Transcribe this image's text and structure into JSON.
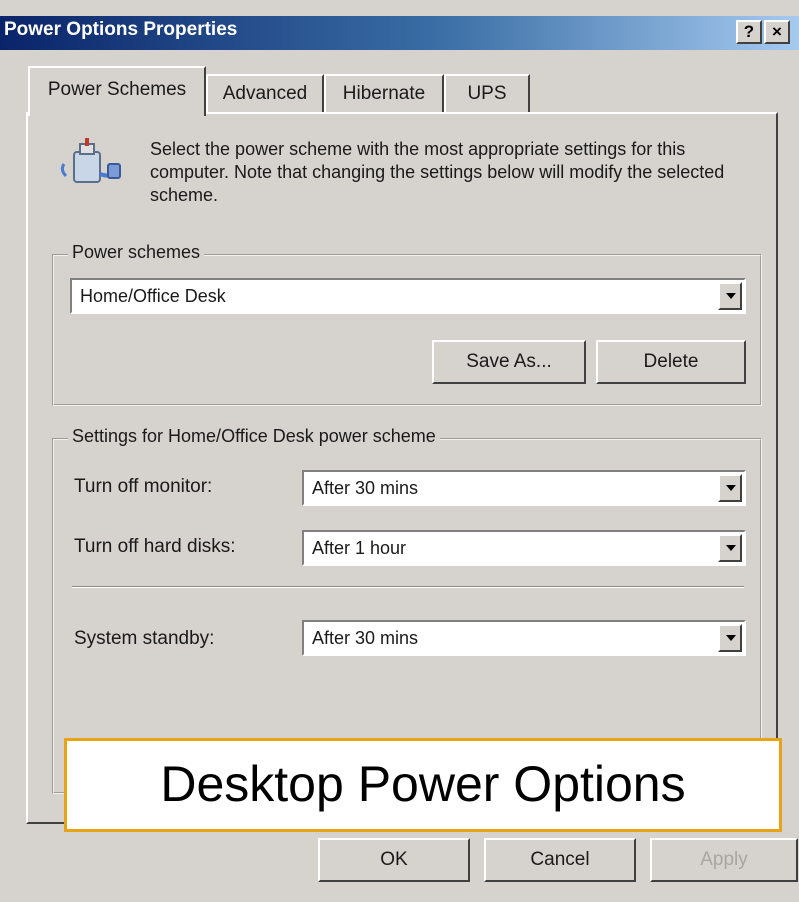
{
  "window": {
    "title": "Power Options Properties",
    "help_glyph": "?",
    "close_glyph": "×"
  },
  "tabs": [
    {
      "label": "Power Schemes",
      "active": true
    },
    {
      "label": "Advanced",
      "active": false
    },
    {
      "label": "Hibernate",
      "active": false
    },
    {
      "label": "UPS",
      "active": false
    }
  ],
  "intro": {
    "icon": "power-scheme-icon",
    "text": "Select the power scheme with the most appropriate settings for this computer. Note that changing the settings below will modify the selected scheme."
  },
  "power_schemes": {
    "group_label": "Power schemes",
    "selected": "Home/Office Desk",
    "save_as_label": "Save As...",
    "delete_label": "Delete"
  },
  "settings": {
    "group_label": "Settings for Home/Office Desk power scheme",
    "monitor_label": "Turn off monitor:",
    "monitor_value": "After 30 mins",
    "disks_label": "Turn off hard disks:",
    "disks_value": "After 1 hour",
    "standby_label": "System standby:",
    "standby_value": "After 30 mins"
  },
  "footer": {
    "ok_label": "OK",
    "cancel_label": "Cancel",
    "apply_label": "Apply"
  },
  "caption": "Desktop Power Options",
  "colors": {
    "title_gradient_start": "#0a246a",
    "title_gradient_end": "#a6caf0",
    "dialog_face": "#d6d3ce",
    "caption_border": "#e8a317"
  }
}
